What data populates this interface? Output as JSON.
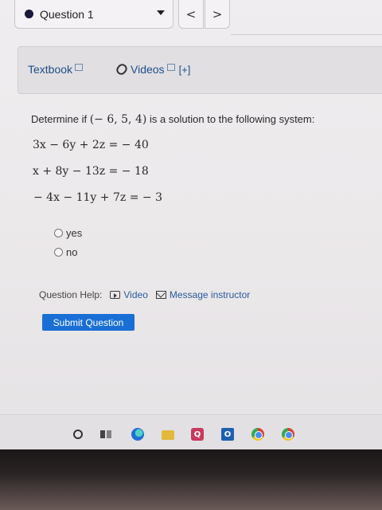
{
  "question_nav": {
    "label": "Question 1",
    "prev_symbol": "<",
    "next_symbol": ">"
  },
  "resources": {
    "textbook_label": "Textbook",
    "videos_label": "Videos",
    "videos_expand": "[+]"
  },
  "question": {
    "prompt_pre": "Determine if",
    "point": "(− 6, 5, 4)",
    "prompt_post": "is a solution to the following system:",
    "equations": [
      "3x − 6y + 2z = − 40",
      "x + 8y − 13z = − 18",
      "− 4x − 11y + 7z = − 3"
    ],
    "options": [
      "yes",
      "no"
    ]
  },
  "help": {
    "label": "Question Help:",
    "video_label": "Video",
    "message_label": "Message instructor"
  },
  "submit_label": "Submit Question",
  "taskbar": {
    "app_letter": "Q",
    "outlook_letter": "O"
  }
}
